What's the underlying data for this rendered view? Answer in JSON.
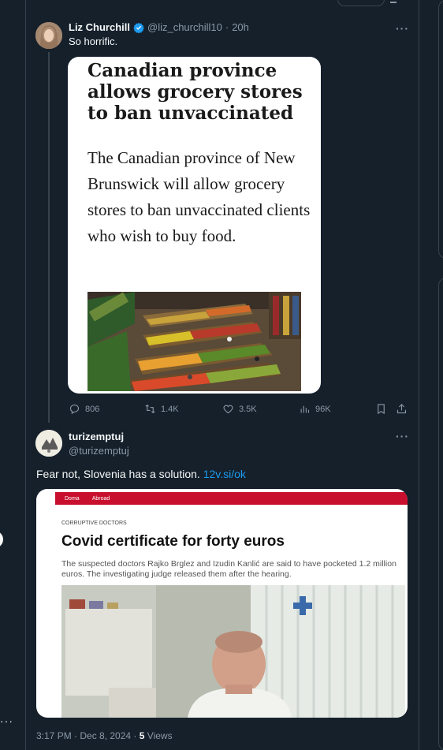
{
  "quoted_tweet": {
    "name": "Liz Churchill",
    "handle": "@liz_churchill10",
    "time": "20h",
    "text": "So horrific.",
    "more": "···",
    "article": {
      "headline": "Canadian province allows grocery stores to ban unvaccinated",
      "body": "The Canadian province of New Brunswick will allow grocery stores to ban unvaccinated clients who wish to buy food."
    },
    "actions": {
      "replies": "806",
      "reposts": "1.4K",
      "likes": "3.5K",
      "views": "96K"
    }
  },
  "main_tweet": {
    "name": "turizemptuj",
    "handle": "@turizemptuj",
    "more": "···",
    "text": "Fear not, Slovenia has a solution.",
    "link": "12v.si/ok",
    "card": {
      "nav_items": [
        "Doma",
        "Abroad"
      ],
      "kicker": "CORRUPTIVE DOCTORS",
      "title": "Covid certificate for forty euros",
      "description": "The suspected doctors Rajko Brglez and Izudin Kanlić are said to have pocketed 1.2 million euros. The investigating judge released them after the hearing."
    },
    "timestamp": "3:17 PM · Dec 8, 2024",
    "views_count": "5",
    "views_label": "Views"
  },
  "left_menu": "···",
  "colors": {
    "background": "#15202b",
    "border": "#38444d",
    "muted": "#8b98a5",
    "link": "#1d9bf0",
    "verified": "#1d9bf0",
    "nav_red": "#c8102e"
  }
}
